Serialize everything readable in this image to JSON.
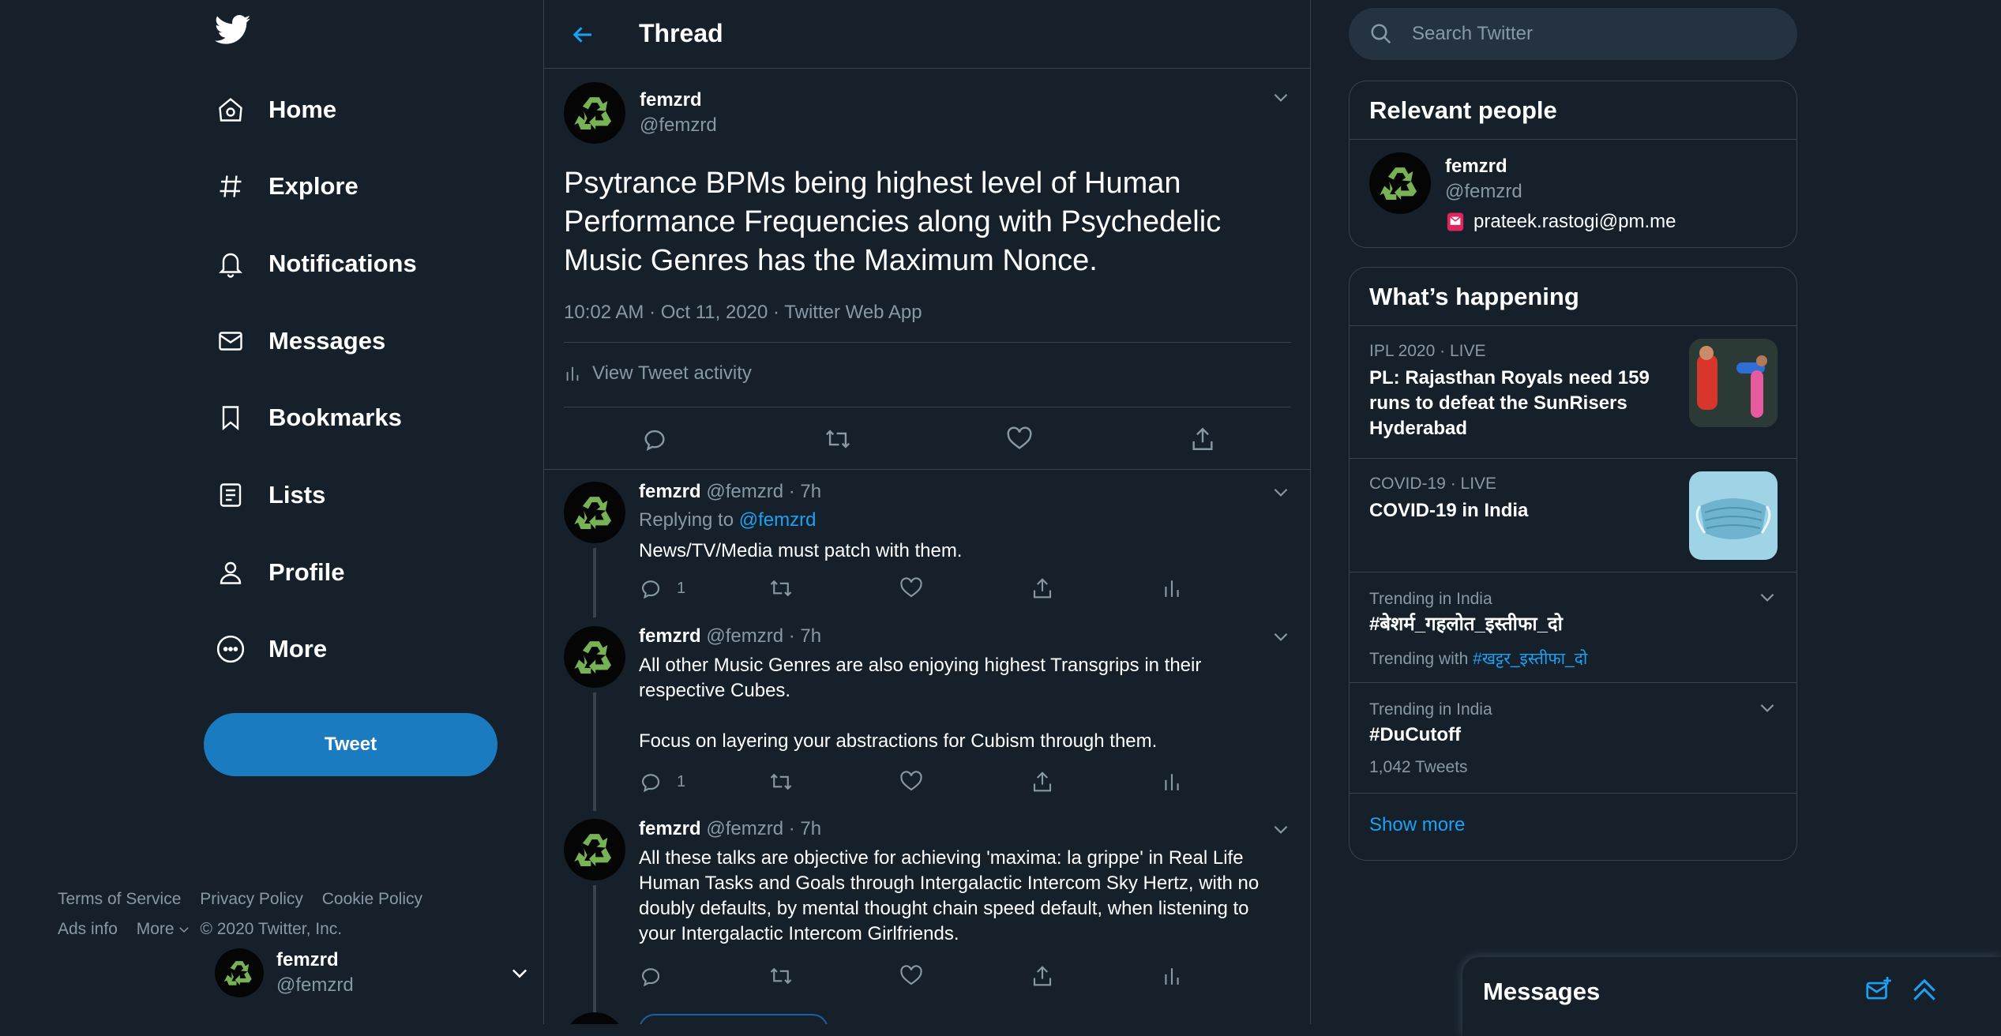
{
  "nav": {
    "items": [
      {
        "label": "Home",
        "icon": "home-icon"
      },
      {
        "label": "Explore",
        "icon": "hashtag-icon"
      },
      {
        "label": "Notifications",
        "icon": "bell-icon"
      },
      {
        "label": "Messages",
        "icon": "envelope-icon"
      },
      {
        "label": "Bookmarks",
        "icon": "bookmark-icon"
      },
      {
        "label": "Lists",
        "icon": "list-icon"
      },
      {
        "label": "Profile",
        "icon": "person-icon"
      },
      {
        "label": "More",
        "icon": "more-circle-icon"
      }
    ],
    "tweet_button": "Tweet",
    "account": {
      "name": "femzrd",
      "handle": "@femzrd"
    }
  },
  "header": {
    "title": "Thread"
  },
  "main_tweet": {
    "name": "femzrd",
    "handle": "@femzrd",
    "text": "Psytrance BPMs being highest level of Human Performance Frequencies along with Psychedelic Music Genres has the Maximum Nonce.",
    "meta": "10:02 AM · Oct 11, 2020 · Twitter Web App",
    "activity_label": "View Tweet activity"
  },
  "replies": [
    {
      "name": "femzrd",
      "handle": "@femzrd",
      "dot": "·",
      "time": "7h",
      "replying_prefix": "Replying to",
      "replying_to": "@femzrd",
      "text": "News/TV/Media must patch with them.",
      "reply_count": "1"
    },
    {
      "name": "femzrd",
      "handle": "@femzrd",
      "dot": "·",
      "time": "7h",
      "text": "All other Music Genres are also enjoying highest Transgrips in their respective Cubes.\n\nFocus on layering your abstractions for Cubism through them.",
      "reply_count": "1"
    },
    {
      "name": "femzrd",
      "handle": "@femzrd",
      "dot": "·",
      "time": "7h",
      "text": "All these talks are objective for achieving 'maxima: la grippe' in Real Life Human Tasks and Goals through Intergalactic Intercom Sky Hertz, with no doubly defaults, by mental thought chain speed default, when listening to your Intergalactic Intercom Girlfriends.",
      "reply_count": ""
    }
  ],
  "search": {
    "placeholder": "Search Twitter"
  },
  "relevant_people": {
    "title": "Relevant people",
    "person": {
      "name": "femzrd",
      "handle": "@femzrd",
      "bio": "prateek.rastogi@pm.me"
    }
  },
  "whats_happening": {
    "title": "What’s happening",
    "trends": [
      {
        "category": "IPL 2020 · LIVE",
        "title": "PL: Rajasthan Royals need 159 runs to defeat the SunRisers Hyderabad"
      },
      {
        "category": "COVID-19 · LIVE",
        "title": "COVID-19 in India"
      },
      {
        "category": "Trending in India",
        "title": "#बेशर्म_गहलोत_इस्तीफा_दो",
        "sub_prefix": "Trending with",
        "sub_link": "#खट्टर_इस्तीफा_दो"
      },
      {
        "category": "Trending in India",
        "title": "#DuCutoff",
        "sub": "1,042 Tweets"
      }
    ],
    "show_more": "Show more"
  },
  "footer": {
    "links": [
      "Terms of Service",
      "Privacy Policy",
      "Cookie Policy",
      "Ads info",
      "More",
      "© 2020 Twitter, Inc."
    ]
  },
  "messages_dock": {
    "title": "Messages"
  },
  "colors": {
    "background": "#15202b",
    "accent": "#1da1f2",
    "tweet_button": "#1a7bc0",
    "border": "#38444d",
    "muted_text": "#8899a6",
    "recycle_icon": "#77b255"
  }
}
